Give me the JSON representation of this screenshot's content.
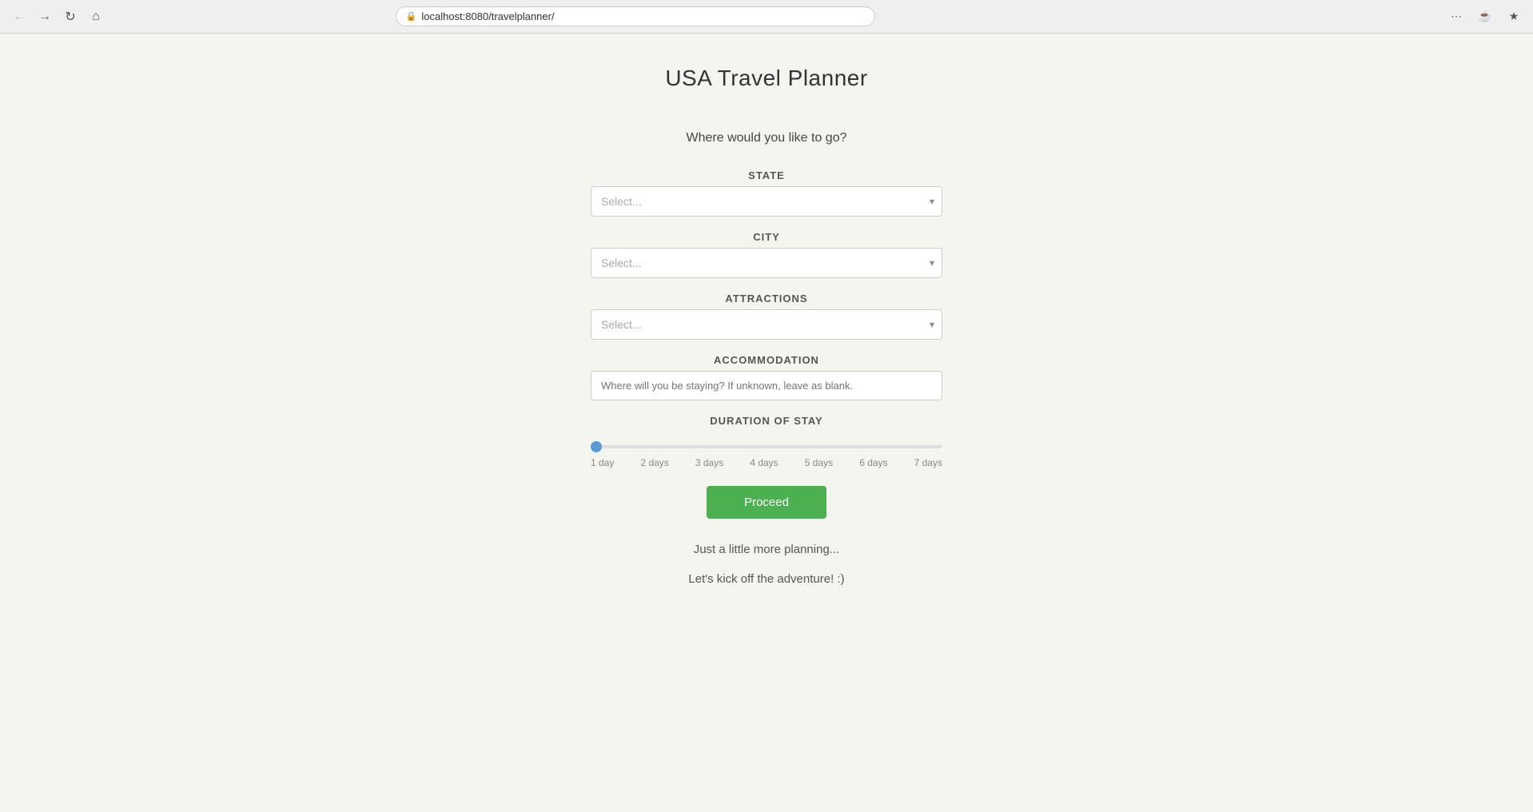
{
  "browser": {
    "url": "localhost:8080/travelplanner/",
    "back_btn": "←",
    "forward_btn": "→",
    "refresh_btn": "↻",
    "home_btn": "⌂"
  },
  "page": {
    "title": "USA Travel Planner",
    "subtitle": "Where would you like to go?",
    "state_label": "STATE",
    "state_placeholder": "Select...",
    "city_label": "CITY",
    "city_placeholder": "Select...",
    "attractions_label": "ATTRACTIONS",
    "attractions_placeholder": "Select...",
    "accommodation_label": "ACCOMMODATION",
    "accommodation_placeholder": "Where will you be staying? If unknown, leave as blank.",
    "duration_label": "DURATION OF STAY",
    "slider_min": 1,
    "slider_max": 7,
    "slider_value": 1,
    "slider_labels": [
      "1 day",
      "2 days",
      "3 days",
      "4 days",
      "5 days",
      "6 days",
      "7 days"
    ],
    "proceed_label": "Proceed",
    "footer_text1": "Just a little more planning...",
    "footer_text2": "Let's kick off the adventure! :)"
  }
}
